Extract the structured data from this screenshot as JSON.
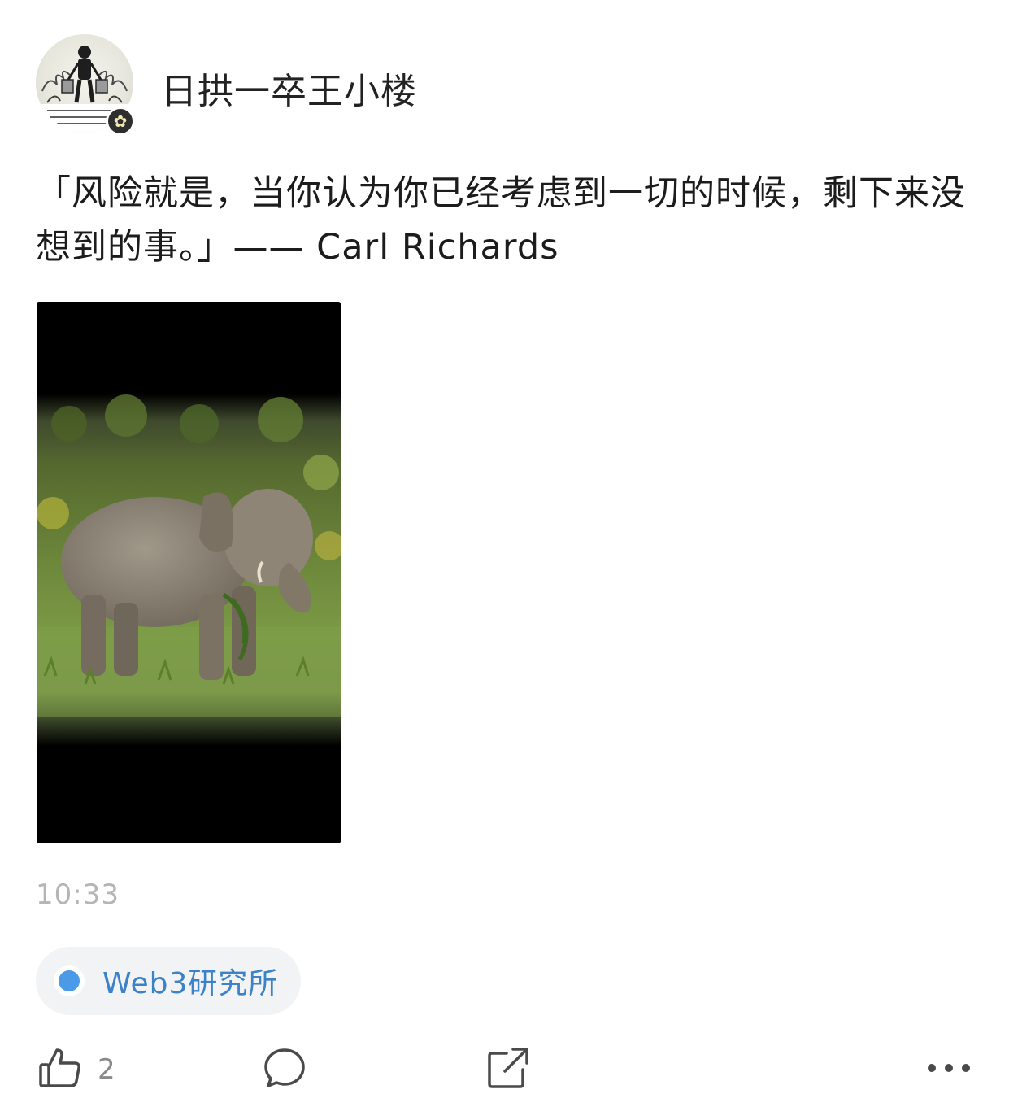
{
  "post": {
    "author": {
      "name": "日拱一卒王小楼",
      "avatar_caption": "Once you carry your water, you will learn the value of every drop",
      "avatar_badge_icon": "flower-badge-icon"
    },
    "text": "「风险就是，当你认为你已经考虑到一切的时候，剩下来没想到的事。」—— Carl Richards",
    "media": {
      "type": "photo",
      "icon": "elephant-photo"
    },
    "timestamp": "10:33",
    "topic": {
      "label": "Web3研究所",
      "accent": "#4a9ae8"
    },
    "actions": {
      "like_count": "2",
      "like_icon": "thumbs-up-icon",
      "comment_icon": "comment-icon",
      "share_icon": "share-icon",
      "more_icon": "more-icon"
    }
  }
}
